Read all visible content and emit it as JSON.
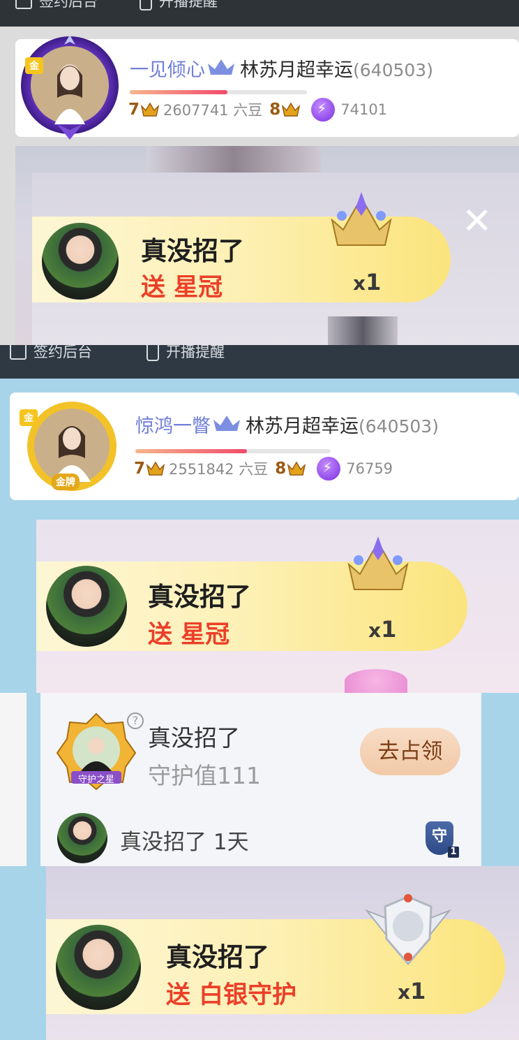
{
  "toolbar": {
    "signin_label": "签约后台",
    "notify_label": "开播提醒"
  },
  "profile_cards": [
    {
      "badge": "金",
      "fan_name": "一见倾心",
      "host_name": "林苏月超幸运",
      "room_id": "(640503)",
      "level_left": "7",
      "beans": "2607741 六豆",
      "level_right": "8",
      "energy": "74101",
      "progress": 0.55
    },
    {
      "badge": "金",
      "fan_name": "惊鸿一瞥",
      "host_name": "林苏月超幸运",
      "room_id": "(640503)",
      "level_left": "7",
      "beans": "2551842 六豆",
      "level_right": "8",
      "energy": "76759",
      "progress": 0.57,
      "medal": "金牌"
    }
  ],
  "gifts": [
    {
      "user": "真没招了",
      "action": "送 星冠",
      "count_x": "x",
      "count": "1",
      "close": "✕"
    },
    {
      "user": "真没招了",
      "action": "送 星冠",
      "count_x": "x",
      "count": "1"
    },
    {
      "user": "真没招了",
      "action": "送 白银守护",
      "count_x": "x",
      "count": "1"
    }
  ],
  "guardian": {
    "name": "真没招了",
    "value_label": "守护值111",
    "occupy_label": "去占领",
    "help": "?",
    "badge_text": "守护之星",
    "footer_name": "真没招了 1天",
    "shield_char": "守",
    "shield_level": "1"
  },
  "colors": {
    "fan_name": "#6f7fd8",
    "gift_action": "#ec3f28",
    "gold": "#f5c51d"
  }
}
